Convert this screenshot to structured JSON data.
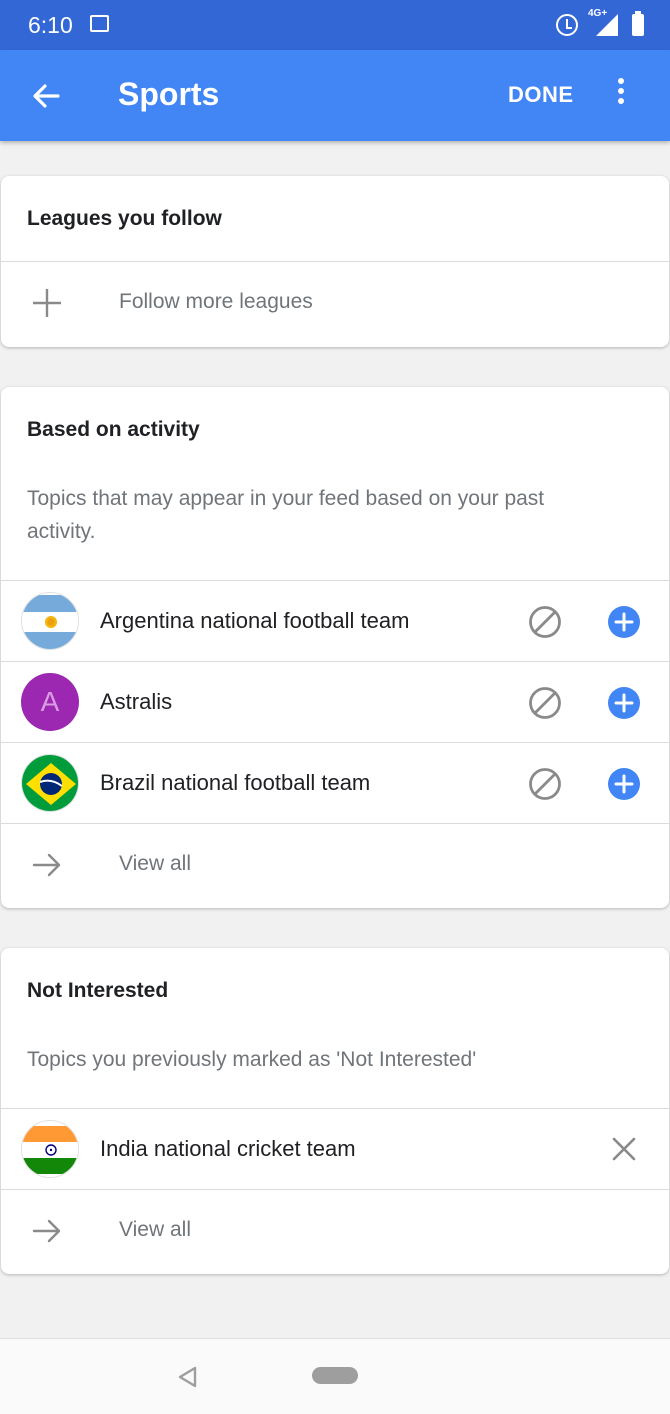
{
  "status_bar": {
    "time": "6:10",
    "network": "4G+"
  },
  "app_bar": {
    "title": "Sports",
    "done_label": "DONE"
  },
  "leagues_card": {
    "title": "Leagues you follow",
    "follow_more_label": "Follow more leagues"
  },
  "activity_card": {
    "title": "Based on activity",
    "description": "Topics that may appear in your feed based on your past activity.",
    "topics": [
      {
        "label": "Argentina national football team",
        "avatar": "argentina-flag"
      },
      {
        "label": "Astralis",
        "avatar": "letter",
        "letter": "A"
      },
      {
        "label": "Brazil national football team",
        "avatar": "brazil-flag"
      }
    ],
    "view_all_label": "View all"
  },
  "not_interested_card": {
    "title": "Not Interested",
    "description": "Topics you previously marked as 'Not Interested'",
    "topics": [
      {
        "label": "India national cricket team",
        "avatar": "india-flag"
      }
    ],
    "view_all_label": "View all"
  },
  "colors": {
    "status_bar": "#3367d6",
    "app_bar": "#4285f4",
    "add_button": "#4285f4",
    "astralis_avatar": "#9c27b0"
  }
}
